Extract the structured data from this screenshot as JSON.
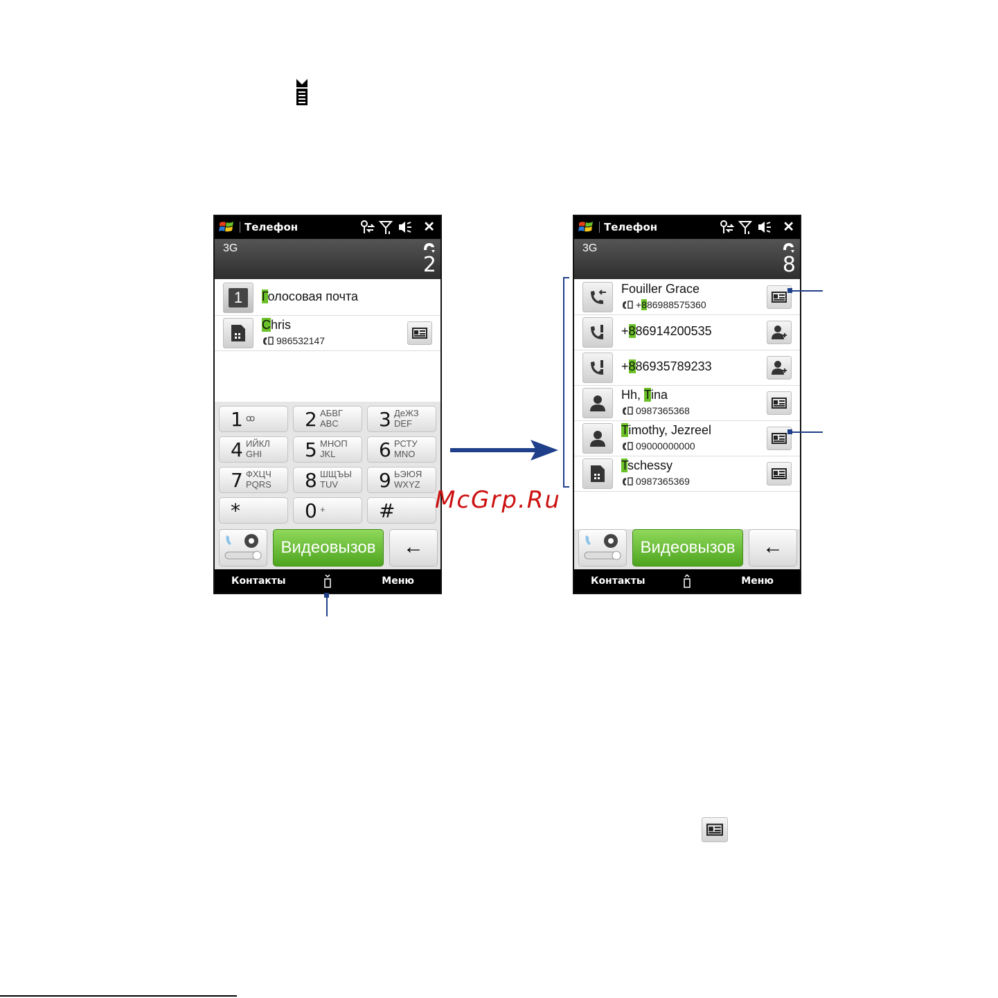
{
  "left_phone": {
    "title": "Телефон",
    "network": "3G",
    "missed_count": "2",
    "results": [
      {
        "highlight": "Г",
        "rest": "олосовая почта",
        "thumb": "1"
      },
      {
        "highlight": "C",
        "rest": "hris",
        "number": "986532147"
      }
    ],
    "keys": [
      {
        "digit": "1",
        "line1": "ꝏ",
        "line2": ""
      },
      {
        "digit": "2",
        "line1": "АБВГ",
        "line2": "ABC"
      },
      {
        "digit": "3",
        "line1": "ДеЖЗ",
        "line2": "DEF"
      },
      {
        "digit": "4",
        "line1": "ИЙКЛ",
        "line2": "GHI"
      },
      {
        "digit": "5",
        "line1": "МНОП",
        "line2": "JKL"
      },
      {
        "digit": "6",
        "line1": "РСТУ",
        "line2": "MNO"
      },
      {
        "digit": "7",
        "line1": "ФХЦЧ",
        "line2": "PQRS"
      },
      {
        "digit": "8",
        "line1": "ШЩЪЫ",
        "line2": "TUV"
      },
      {
        "digit": "9",
        "line1": "ЬЭЮЯ",
        "line2": "WXYZ"
      },
      {
        "digit": "*",
        "line1": "",
        "line2": ""
      },
      {
        "digit": "0",
        "line1": "+",
        "line2": ""
      },
      {
        "digit": "#",
        "line1": "",
        "line2": ""
      }
    ],
    "video_button": "Видеовызов",
    "back_symbol": "←",
    "softkey_left": "Контакты",
    "softkey_right": "Меню"
  },
  "right_phone": {
    "title": "Телефон",
    "network": "3G",
    "missed_count": "8",
    "results": [
      {
        "prefix": "Fouiller Grace",
        "highlight": "",
        "rest": "",
        "number_prefix": "+",
        "number_highlight": "8",
        "number_rest": "86988575360",
        "thumb_icon": "incoming-call-icon",
        "action_icon": "contact-card-icon"
      },
      {
        "prefix": "+",
        "highlight": "8",
        "rest": "86914200535",
        "thumb_icon": "missed-call-icon",
        "action_icon": "add-contact-icon"
      },
      {
        "prefix": "+",
        "highlight": "8",
        "rest": "86935789233",
        "thumb_icon": "missed-call-icon",
        "action_icon": "add-contact-icon"
      },
      {
        "prefix": "Hh, ",
        "highlight": "T",
        "rest": "ina",
        "number": "0987365368",
        "thumb_icon": "person-icon",
        "action_icon": "contact-card-icon"
      },
      {
        "prefix": "",
        "highlight": "T",
        "rest": "imothy, Jezreel",
        "number": "09000000000",
        "thumb_icon": "person-icon",
        "action_icon": "contact-card-icon"
      },
      {
        "prefix": "",
        "highlight": "T",
        "rest": "schessy",
        "number": "0987365369",
        "thumb_icon": "sim-icon",
        "action_icon": "contact-card-icon"
      }
    ],
    "video_button": "Видеовызов",
    "back_symbol": "←",
    "softkey_left": "Контакты",
    "softkey_right": "Меню"
  },
  "watermark": "McGrp.Ru",
  "colors": {
    "highlight": "#6bc127",
    "video_button": "#5cb22a",
    "callout": "#1f3f8a",
    "watermark": "#cc1111"
  }
}
